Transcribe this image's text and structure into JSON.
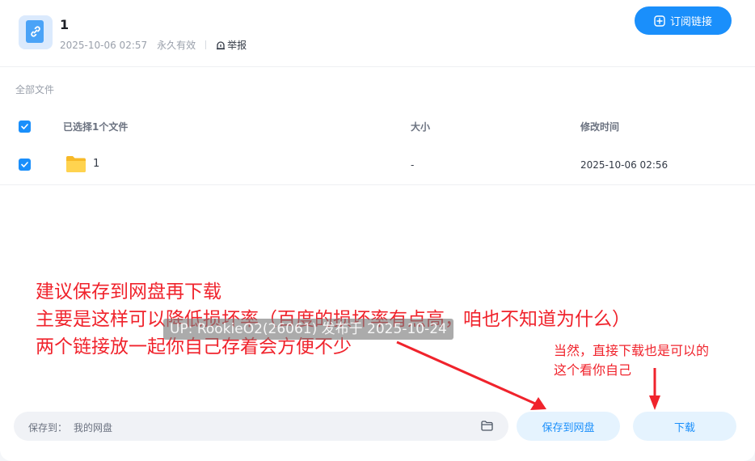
{
  "share": {
    "title": "1",
    "date": "2025-10-06 02:57",
    "validity": "永久有效",
    "report_label": "举报",
    "subscribe_label": "订阅链接"
  },
  "breadcrumb": "全部文件",
  "table": {
    "headers": {
      "selection": "已选择1个文件",
      "size": "大小",
      "modified": "修改时间"
    },
    "rows": [
      {
        "name": "1",
        "size": "-",
        "modified": "2025-10-06 02:56",
        "type": "folder",
        "checked": true
      }
    ]
  },
  "annotations": {
    "main_lines": [
      "建议保存到网盘再下载",
      "主要是这样可以降低损坏率（百度的损坏率有点高，咱也不知道为什么）",
      "两个链接放一起你自己存着会方便不少"
    ],
    "watermark": "UP: RookieO2(26061) 发布于 2025-10-24",
    "side_lines": [
      "当然，直接下载也是可以的",
      "这个看你自己"
    ],
    "color": "#f0232c"
  },
  "footer": {
    "save_to_label": "保存到：",
    "save_path": "我的网盘",
    "save_button": "保存到网盘",
    "download_button": "下载"
  },
  "colors": {
    "accent": "#1a8ffb",
    "accent_light": "#e5f3fe"
  }
}
